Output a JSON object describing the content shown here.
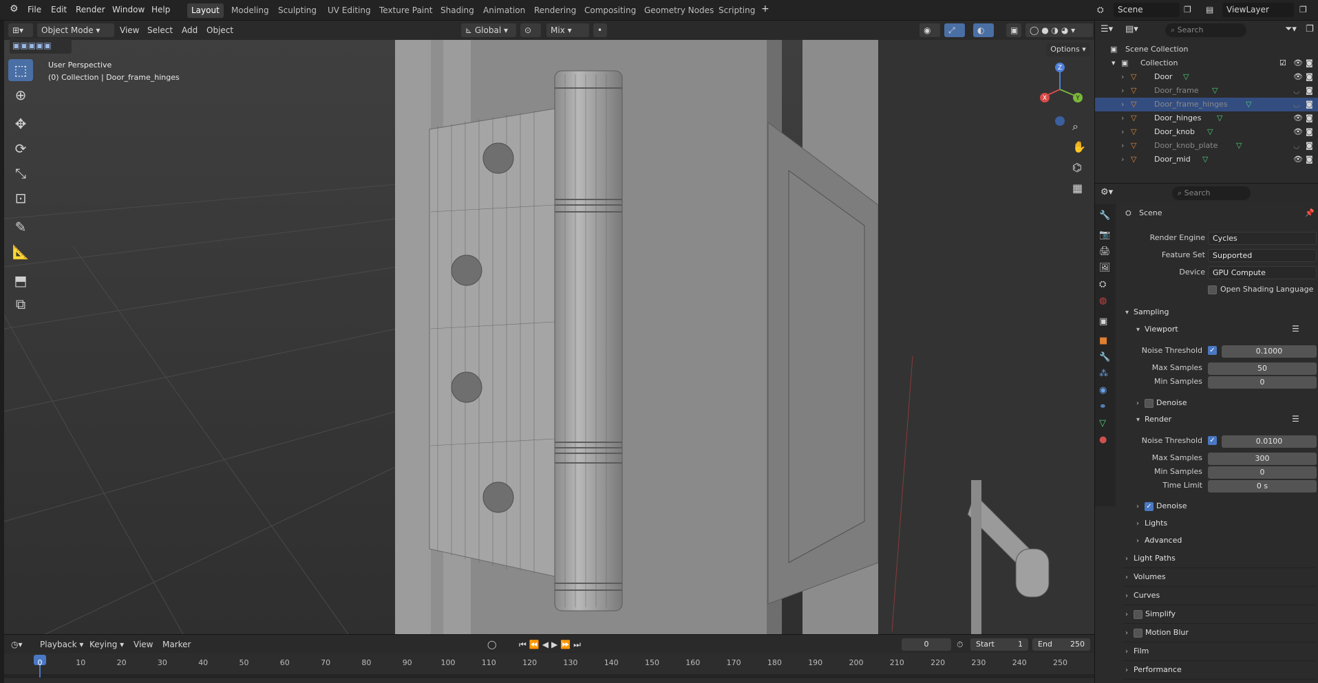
{
  "menu": [
    "File",
    "Edit",
    "Render",
    "Window",
    "Help"
  ],
  "workspaces": [
    "Layout",
    "Modeling",
    "Sculpting",
    "UV Editing",
    "Texture Paint",
    "Shading",
    "Animation",
    "Rendering",
    "Compositing",
    "Geometry Nodes",
    "Scripting"
  ],
  "active_workspace": "Layout",
  "scene_field": "Scene",
  "viewlayer_field": "ViewLayer",
  "viewport_header": {
    "mode": "Object Mode",
    "menus": [
      "View",
      "Select",
      "Add",
      "Object"
    ],
    "orientation": "Global",
    "snap": "Mix",
    "options": "Options"
  },
  "viewport_overlay": {
    "line1": "User Perspective",
    "line2": "(0) Collection | Door_frame_hinges"
  },
  "gizmo": {
    "z": "Z",
    "x": "X",
    "y": "Y"
  },
  "outliner": {
    "search_placeholder": "Search",
    "root": "Scene Collection",
    "collection": "Collection",
    "items": [
      {
        "name": "Door",
        "dim": false,
        "selected": false
      },
      {
        "name": "Door_frame",
        "dim": true,
        "selected": false
      },
      {
        "name": "Door_frame_hinges",
        "dim": true,
        "selected": true
      },
      {
        "name": "Door_hinges",
        "dim": false,
        "selected": false
      },
      {
        "name": "Door_knob",
        "dim": false,
        "selected": false
      },
      {
        "name": "Door_knob_plate",
        "dim": true,
        "selected": false
      },
      {
        "name": "Door_mid",
        "dim": false,
        "selected": false
      }
    ]
  },
  "properties": {
    "search_placeholder": "Search",
    "context": "Scene",
    "render_engine_label": "Render Engine",
    "render_engine": "Cycles",
    "feature_set_label": "Feature Set",
    "feature_set": "Supported",
    "device_label": "Device",
    "device": "GPU Compute",
    "osl_label": "Open Shading Language",
    "sampling": "Sampling",
    "viewport": "Viewport",
    "vp_noise_label": "Noise Threshold",
    "vp_noise": "0.1000",
    "vp_max_label": "Max Samples",
    "vp_max": "50",
    "vp_min_label": "Min Samples",
    "vp_min": "0",
    "vp_denoise": "Denoise",
    "render": "Render",
    "r_noise_label": "Noise Threshold",
    "r_noise": "0.0100",
    "r_max_label": "Max Samples",
    "r_max": "300",
    "r_min_label": "Min Samples",
    "r_min": "0",
    "r_time_label": "Time Limit",
    "r_time": "0 s",
    "r_denoise": "Denoise",
    "lights": "Lights",
    "advanced": "Advanced",
    "sections": [
      "Light Paths",
      "Volumes",
      "Curves",
      "Simplify",
      "Motion Blur",
      "Film",
      "Performance"
    ]
  },
  "timeline": {
    "menus": [
      "Playback",
      "Keying",
      "View",
      "Marker"
    ],
    "current_frame": "0",
    "start_label": "Start",
    "start": "1",
    "end_label": "End",
    "end": "250",
    "ticks": [
      "0",
      "10",
      "20",
      "30",
      "40",
      "50",
      "60",
      "70",
      "80",
      "90",
      "100",
      "110",
      "120",
      "130",
      "140",
      "150",
      "160",
      "170",
      "180",
      "190",
      "200",
      "210",
      "220",
      "230",
      "240",
      "250"
    ]
  }
}
